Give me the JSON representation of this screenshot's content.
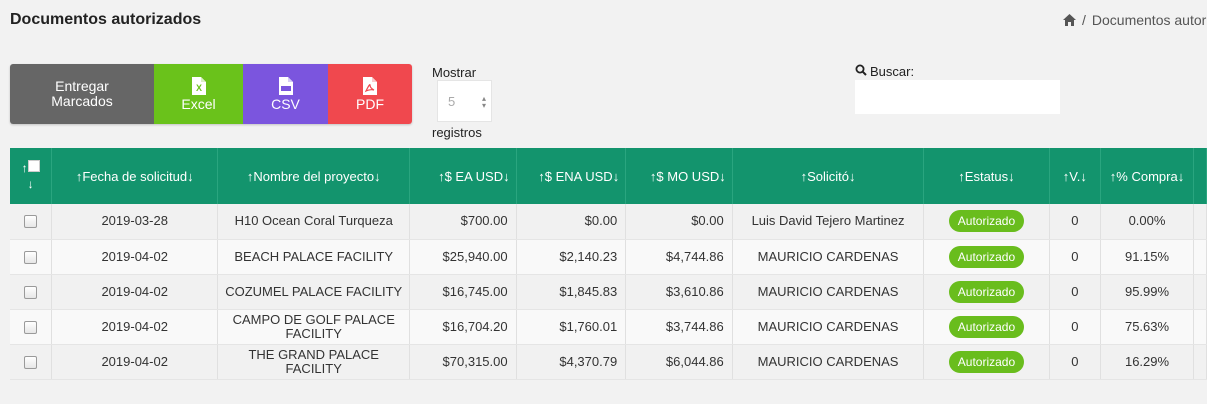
{
  "header": {
    "title": "Documentos autorizados",
    "breadcrumb": "Documentos autor"
  },
  "toolbar": {
    "deliver_line1": "Entregar",
    "deliver_line2": "Marcados",
    "excel": "Excel",
    "csv": "CSV",
    "pdf": "PDF"
  },
  "length": {
    "prefix": "Mostrar",
    "value": "5",
    "suffix": "registros"
  },
  "search": {
    "label": "Buscar:",
    "value": ""
  },
  "table": {
    "columns": [
      "↑Fecha de solicitud↓",
      "↑Nombre del proyecto↓",
      "↑$ EA USD↓",
      "↑$ ENA USD↓",
      "↑$ MO USD↓",
      "↑Solicitó↓",
      "↑Estatus↓",
      "↑V.↓",
      "↑% Compra↓"
    ],
    "rows": [
      {
        "fecha": "2019-03-28",
        "proyecto": "H10 Ocean Coral Turqueza",
        "ea": "$700.00",
        "ena": "$0.00",
        "mo": "$0.00",
        "solicito": "Luis David Tejero Martinez",
        "estatus": "Autorizado",
        "v": "0",
        "compra": "0.00%"
      },
      {
        "fecha": "2019-04-02",
        "proyecto": "BEACH PALACE FACILITY",
        "ea": "$25,940.00",
        "ena": "$2,140.23",
        "mo": "$4,744.86",
        "solicito": "MAURICIO CARDENAS",
        "estatus": "Autorizado",
        "v": "0",
        "compra": "91.15%"
      },
      {
        "fecha": "2019-04-02",
        "proyecto": "COZUMEL PALACE FACILITY",
        "ea": "$16,745.00",
        "ena": "$1,845.83",
        "mo": "$3,610.86",
        "solicito": "MAURICIO CARDENAS",
        "estatus": "Autorizado",
        "v": "0",
        "compra": "95.99%"
      },
      {
        "fecha": "2019-04-02",
        "proyecto": "CAMPO DE GOLF PALACE FACILITY",
        "ea": "$16,704.20",
        "ena": "$1,760.01",
        "mo": "$3,744.86",
        "solicito": "MAURICIO CARDENAS",
        "estatus": "Autorizado",
        "v": "0",
        "compra": "75.63%"
      },
      {
        "fecha": "2019-04-02",
        "proyecto": "THE GRAND PALACE FACILITY",
        "ea": "$70,315.00",
        "ena": "$4,370.79",
        "mo": "$6,044.86",
        "solicito": "MAURICIO CARDENAS",
        "estatus": "Autorizado",
        "v": "0",
        "compra": "16.29%"
      }
    ]
  },
  "colors": {
    "header_green": "#13946d",
    "badge_green": "#69bd1d",
    "excel_green": "#6ac21b",
    "csv_purple": "#7b55de",
    "pdf_red": "#f0484e",
    "deliver_gray": "#666666"
  },
  "icons": {
    "breadcrumb": "home-icon",
    "excel": "file-excel-icon",
    "csv": "file-csv-icon",
    "pdf": "file-pdf-icon",
    "search": "search-icon"
  }
}
